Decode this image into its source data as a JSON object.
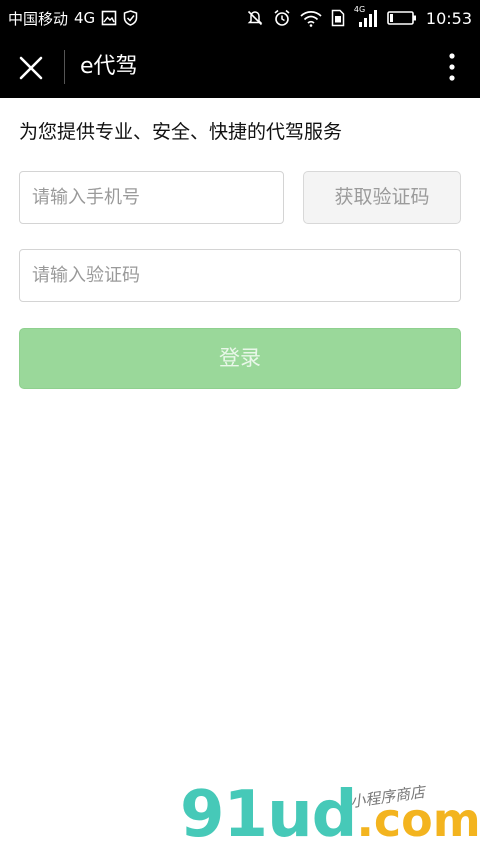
{
  "status_bar": {
    "carrier": "中国移动",
    "network": "4G",
    "signal_network": "4G",
    "time": "10:53",
    "icons": [
      "image-icon",
      "shield-icon",
      "mute-icon",
      "alarm-icon",
      "wifi-icon",
      "sim-icon",
      "signal-icon",
      "battery-icon"
    ]
  },
  "nav_bar": {
    "title": "e代驾",
    "close_icon": "close-icon",
    "more_icon": "more-vertical-icon"
  },
  "form": {
    "tagline": "为您提供专业、安全、快捷的代驾服务",
    "phone_placeholder": "请输入手机号",
    "get_code_label": "获取验证码",
    "code_placeholder": "请输入验证码",
    "login_label": "登录"
  },
  "watermark": {
    "logo_main": "91ud",
    "logo_suffix": ".com",
    "script_text": "小程序商店"
  },
  "colors": {
    "status_bg": "#000000",
    "nav_bg": "#000000",
    "login_bg": "#9ad89a",
    "get_code_bg": "#f4f4f4",
    "watermark_teal": "#46c9b8",
    "watermark_orange": "#f3b41f"
  }
}
